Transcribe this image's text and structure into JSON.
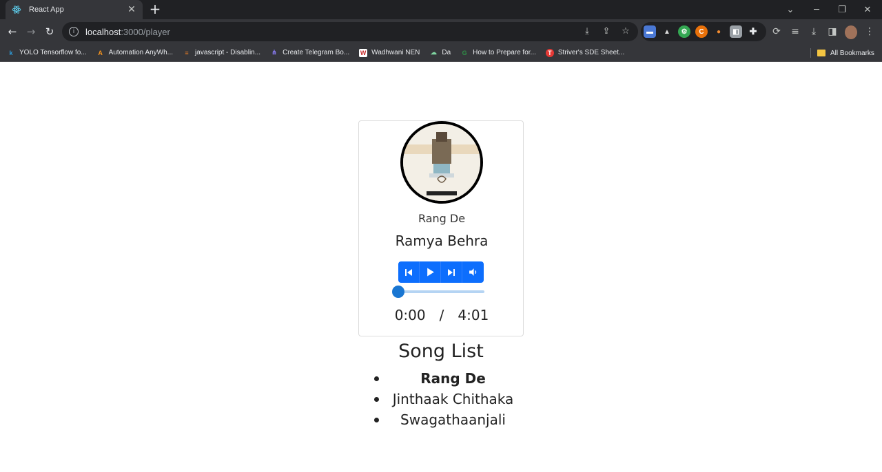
{
  "browser": {
    "tab_title": "React App",
    "url_host": "localhost",
    "url_path": ":3000/player",
    "bookmarks": [
      {
        "label": "YOLO Tensorflow fo...",
        "icon": "k-icon",
        "color": "#2d9cdb",
        "glyph": "k"
      },
      {
        "label": "Automation AnyWh...",
        "icon": "automation-anywhere-icon",
        "color": "#f7941d",
        "glyph": "A"
      },
      {
        "label": "javascript - Disablin...",
        "icon": "stackoverflow-icon",
        "color": "#f48024",
        "glyph": "≡"
      },
      {
        "label": "Create Telegram Bo...",
        "icon": "network-icon",
        "color": "#6c63ff",
        "glyph": "⋔"
      },
      {
        "label": "Wadhwani NEN",
        "icon": "wadhwani-icon",
        "color": "#ffffff",
        "glyph": "W"
      },
      {
        "label": "Da",
        "icon": "brain-icon",
        "color": "#7fd4a0",
        "glyph": "☁"
      },
      {
        "label": "How to Prepare for...",
        "icon": "gfg-icon",
        "color": "#2f8d46",
        "glyph": "G"
      },
      {
        "label": "Striver's SDE Sheet...",
        "icon": "tuf-icon",
        "color": "#e53935",
        "glyph": "T"
      }
    ],
    "all_bookmarks": "All Bookmarks"
  },
  "player": {
    "song_title": "Rang De",
    "artist": "Ramya Behra",
    "current_time": "0:00",
    "separator": "/",
    "duration": "4:01",
    "progress": 0
  },
  "song_list": {
    "title": "Song List",
    "items": [
      {
        "name": "Rang De",
        "active": true
      },
      {
        "name": "Jinthaak Chithaka",
        "active": false
      },
      {
        "name": "Swagathaanjali",
        "active": false
      }
    ]
  },
  "colors": {
    "accent": "#0d6efd",
    "slider": "#1976d2"
  }
}
